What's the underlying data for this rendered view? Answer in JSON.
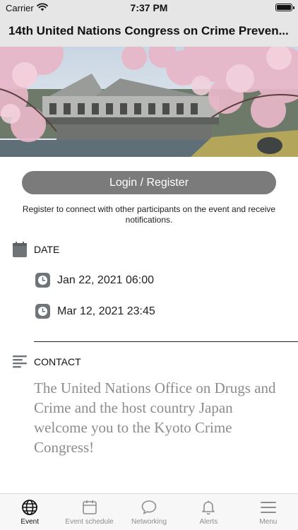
{
  "status_bar": {
    "carrier": "Carrier",
    "time": "7:37 PM"
  },
  "nav": {
    "title": "14th United Nations Congress on Crime Preven..."
  },
  "login": {
    "button_label": "Login / Register",
    "note": "Register to connect with other participants on the event and receive notifications."
  },
  "date_section": {
    "label": "DATE",
    "start": "Jan 22, 2021 06:00",
    "end": "Mar 12, 2021 23:45"
  },
  "contact_section": {
    "label": "CONTACT",
    "text": "The United Nations Office on Drugs and Crime and the host country Japan welcome you to the Kyoto Crime Congress!"
  },
  "tabs": [
    {
      "label": "Event",
      "icon": "globe-icon",
      "active": true
    },
    {
      "label": "Event schedule",
      "icon": "calendar-icon",
      "active": false
    },
    {
      "label": "Networking",
      "icon": "chat-bubble-icon",
      "active": false
    },
    {
      "label": "Alerts",
      "icon": "bell-icon",
      "active": false
    },
    {
      "label": "Menu",
      "icon": "hamburger-menu-icon",
      "active": false
    }
  ],
  "colors": {
    "bars": "#e6e6e6",
    "login_button": "#7b7b7b",
    "icon_gray": "#6f7478",
    "contact_text": "#8c8c8c"
  }
}
